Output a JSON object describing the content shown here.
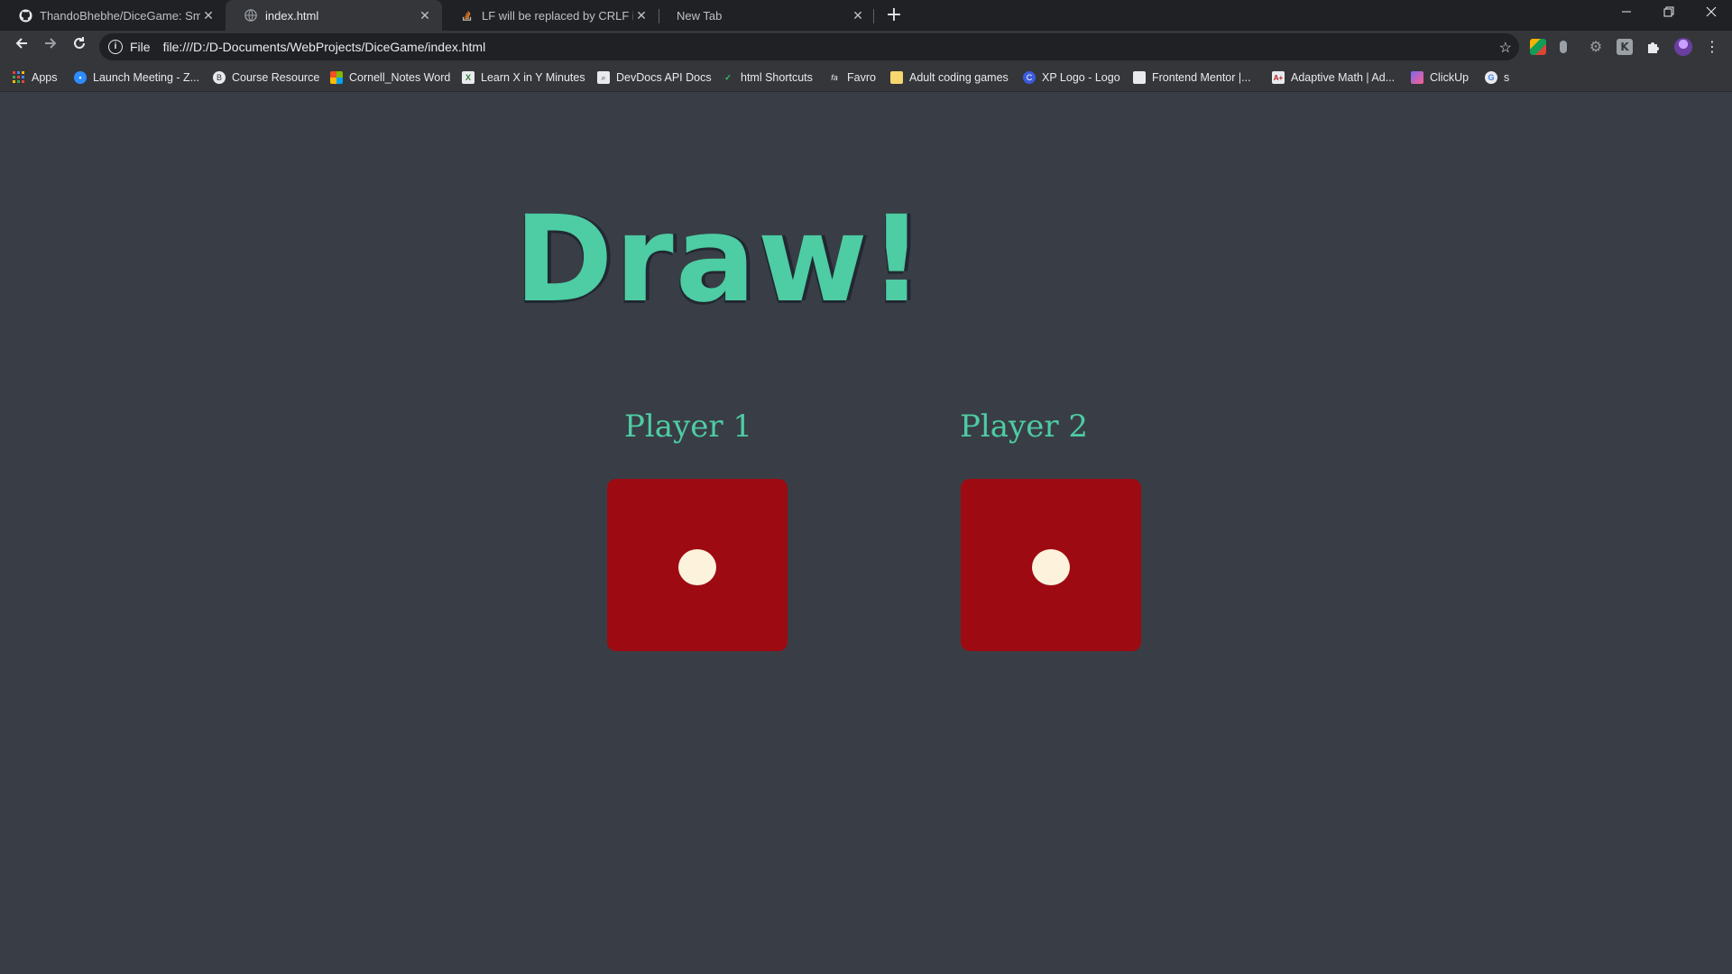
{
  "tabs": [
    {
      "title": "ThandoBhebhe/DiceGame: Smal",
      "icon": "github-icon"
    },
    {
      "title": "index.html",
      "icon": "globe-icon"
    },
    {
      "title": "LF will be replaced by CRLF in git",
      "icon": "stackoverflow-icon"
    },
    {
      "title": "New Tab",
      "icon": ""
    }
  ],
  "address_bar": {
    "scheme_label": "File",
    "url": "file:///D:/D-Documents/WebProjects/DiceGame/index.html"
  },
  "bookmarks": [
    {
      "label": "Apps",
      "icon": "apps-grid-icon"
    },
    {
      "label": "Launch Meeting - Z...",
      "icon": "zoom-icon"
    },
    {
      "label": "Course Resource",
      "icon": "course-icon"
    },
    {
      "label": "Cornell_Notes Word",
      "icon": "microsoft-icon"
    },
    {
      "label": "Learn X in Y Minutes",
      "icon": "learnx-icon"
    },
    {
      "label": "DevDocs API Docs",
      "icon": "devdocs-icon"
    },
    {
      "label": "html Shortcuts",
      "icon": "vim-icon"
    },
    {
      "label": "Favro",
      "icon": "favro-icon"
    },
    {
      "label": "Adult coding games",
      "icon": "folder-icon"
    },
    {
      "label": "XP Logo - Logo",
      "icon": "xp-logo-icon"
    },
    {
      "label": "Frontend Mentor |...",
      "icon": "frontend-mentor-icon"
    },
    {
      "label": "Adaptive Math | Ad...",
      "icon": "adaptive-math-icon"
    },
    {
      "label": "ClickUp",
      "icon": "clickup-icon"
    },
    {
      "label": "s",
      "icon": "google-icon"
    }
  ],
  "game": {
    "headline": "Draw!",
    "player1": {
      "label": "Player 1",
      "die_value": 1
    },
    "player2": {
      "label": "Player 2",
      "die_value": 1
    }
  },
  "colors": {
    "background": "#393e46",
    "accent": "#4ecca3",
    "die": "#9d0a12",
    "pip": "#fdf2dc"
  }
}
